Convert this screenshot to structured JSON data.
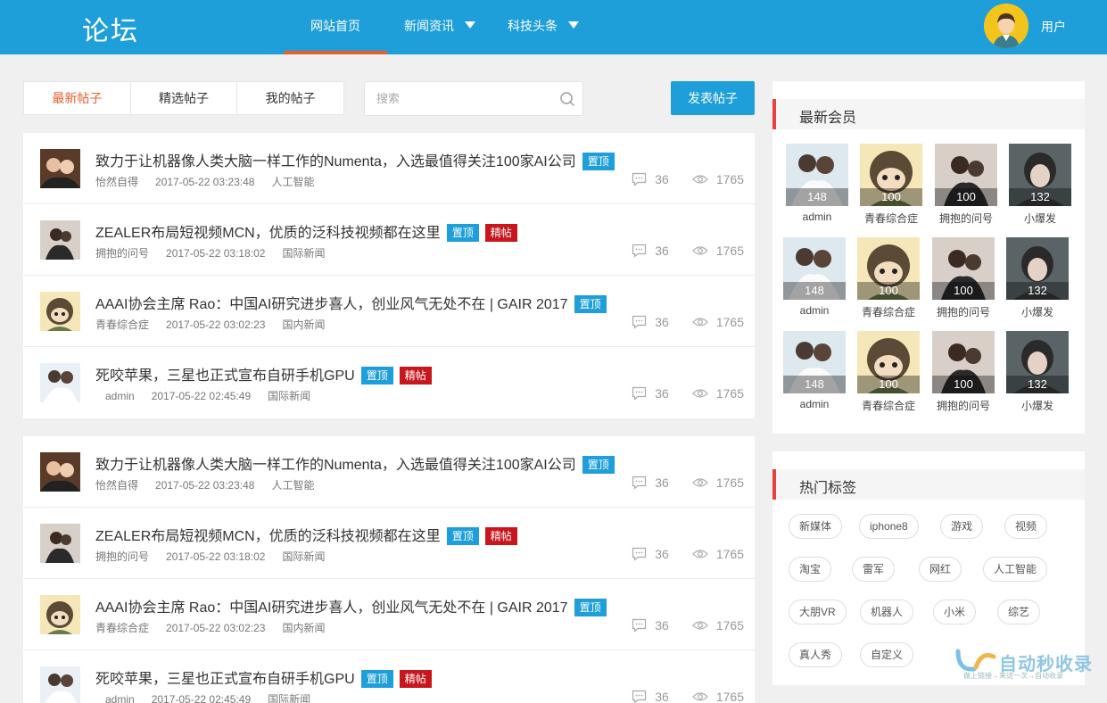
{
  "header": {
    "logo": "论坛",
    "nav": [
      {
        "label": "网站首页"
      },
      {
        "label": "新闻资讯"
      },
      {
        "label": "科技头条"
      }
    ],
    "user": "用户"
  },
  "toolbar": {
    "tabs": [
      "最新帖子",
      "精选帖子",
      "我的帖子"
    ],
    "search_placeholder": "搜索",
    "post_button": "发表帖子"
  },
  "posts": [
    {
      "title": "致力于让机器像人类大脑一样工作的Numenta，入选最值得关注100家AI公司",
      "badges": [
        "置顶"
      ],
      "author": "怡然自得",
      "time": "2017-05-22 03:23:48",
      "category": "人工智能",
      "comments": "36",
      "views": "1765"
    },
    {
      "title": "ZEALER布局短视频MCN，优质的泛科技视频都在这里",
      "badges": [
        "置顶",
        "精帖"
      ],
      "author": "拥抱的问号",
      "time": "2017-05-22 03:18:02",
      "category": "国际新闻",
      "comments": "36",
      "views": "1765"
    },
    {
      "title": "AAAI协会主席 Rao：中国AI研究进步喜人，创业风气无处不在 | GAIR 2017",
      "badges": [
        "置顶"
      ],
      "author": "青春综合症",
      "time": "2017-05-22 03:02:23",
      "category": "国内新闻",
      "comments": "36",
      "views": "1765"
    },
    {
      "title": "死咬苹果，三星也正式宣布自研手机GPU",
      "badges": [
        "置顶",
        "精帖"
      ],
      "author": "admin",
      "time": "2017-05-22 02:45:49",
      "category": "国际新闻",
      "comments": "36",
      "views": "1765"
    }
  ],
  "sidebar": {
    "members_title": "最新会员",
    "members": [
      {
        "name": "admin",
        "count": "148"
      },
      {
        "name": "青春综合症",
        "count": "100"
      },
      {
        "name": "拥抱的问号",
        "count": "100"
      },
      {
        "name": "小爆发",
        "count": "132"
      }
    ],
    "tags_title": "热门标签",
    "tags": [
      "新媒体",
      "iphone8",
      "游戏",
      "视频",
      "淘宝",
      "雷军",
      "网红",
      "人工智能",
      "大朋VR",
      "机器人",
      "小米",
      "综艺",
      "真人秀",
      "自定义"
    ]
  },
  "watermark": {
    "text": "自动秒收录",
    "sub": "做上链接→来访一次→自动收录"
  }
}
